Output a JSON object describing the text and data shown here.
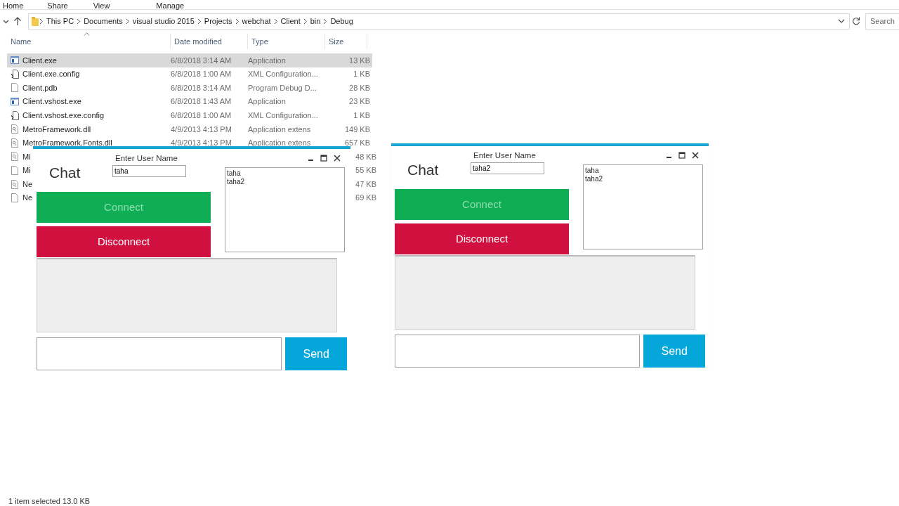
{
  "explorer": {
    "ribbon_tabs": [
      {
        "label": "Home"
      },
      {
        "label": "Share"
      },
      {
        "label": "View"
      },
      {
        "label": "Manage"
      }
    ],
    "address_path": [
      "This PC",
      "Documents",
      "visual studio 2015",
      "Projects",
      "webchat",
      "Client",
      "bin",
      "Debug"
    ],
    "search": {
      "placeholder": "Search"
    },
    "columns": [
      "Name",
      "Date modified",
      "Type",
      "Size"
    ],
    "rows": [
      {
        "kind": "exe",
        "name": "Client.exe",
        "date": "6/8/2018 3:14 AM",
        "type": "Application",
        "size": "13 KB",
        "selected": true
      },
      {
        "kind": "config",
        "name": "Client.exe.config",
        "date": "6/8/2018 1:00 AM",
        "type": "XML Configuration...",
        "size": "1 KB",
        "selected": false
      },
      {
        "kind": "file",
        "name": "Client.pdb",
        "date": "6/8/2018 3:14 AM",
        "type": "Program Debug D...",
        "size": "28 KB",
        "selected": false
      },
      {
        "kind": "exe",
        "name": "Client.vshost.exe",
        "date": "6/8/2018 1:43 AM",
        "type": "Application",
        "size": "23 KB",
        "selected": false
      },
      {
        "kind": "config",
        "name": "Client.vshost.exe.config",
        "date": "6/8/2018 1:00 AM",
        "type": "XML Configuration...",
        "size": "1 KB",
        "selected": false
      },
      {
        "kind": "dll",
        "name": "MetroFramework.dll",
        "date": "4/9/2013 4:13 PM",
        "type": "Application extens",
        "size": "149 KB",
        "selected": false
      },
      {
        "kind": "dll",
        "name": "MetroFramework.Fonts.dll",
        "date": "4/9/2013 4:13 PM",
        "type": "Application extens",
        "size": "657 KB",
        "selected": false
      },
      {
        "kind": "dll",
        "name": "Mi",
        "size": "48 KB",
        "selected": false
      },
      {
        "kind": "file",
        "name": "Mi",
        "size": "55 KB",
        "selected": false
      },
      {
        "kind": "dll",
        "name": "Ne",
        "size": "47 KB",
        "selected": false
      },
      {
        "kind": "file",
        "name": "Ne",
        "size": "69 KB",
        "selected": false
      }
    ],
    "status_bar": "1 item selected  13.0 KB"
  },
  "chat_windows": [
    {
      "title": "Chat",
      "username_label": "Enter User Name",
      "username": "taha",
      "users": [
        "taha",
        "taha2"
      ],
      "connect": {
        "label": "Connect",
        "disabled": true
      },
      "disconnect": {
        "label": "Disconnect",
        "disabled": false
      },
      "send": "Send"
    },
    {
      "title": "Chat",
      "username_label": "Enter User Name",
      "username": "taha2",
      "users": [
        "taha",
        "taha2"
      ],
      "connect": {
        "label": "Connect",
        "disabled": true
      },
      "disconnect": {
        "label": "Disconnect",
        "disabled": false
      },
      "send": "Send"
    }
  ]
}
